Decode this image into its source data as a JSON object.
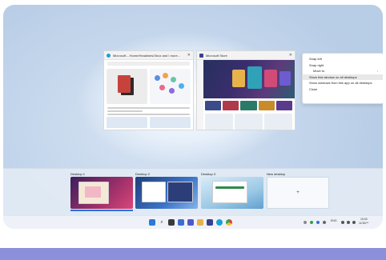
{
  "edge_window": {
    "title": "Microsoft – Home/Headlines/Xbox and I more...",
    "close_glyph": "✕"
  },
  "store_window": {
    "title": "Microsoft Store",
    "close_glyph": "✕"
  },
  "context_menu": {
    "items": [
      {
        "label": "Snap left"
      },
      {
        "label": "Snap right"
      },
      {
        "label": "Move to",
        "has_submenu": true
      },
      {
        "label": "Show this window on all desktops",
        "highlighted": true
      },
      {
        "label": "Show windows from this app on all desktops"
      },
      {
        "label": "Close"
      }
    ],
    "submenu_arrow": "›"
  },
  "desktops": [
    {
      "label": "Desktop 1",
      "active": true
    },
    {
      "label": "Desktop 2",
      "active": false
    },
    {
      "label": "Desktop 3",
      "active": false
    }
  ],
  "new_desktop": {
    "label": "New desktop",
    "glyph": "+"
  },
  "taskbar": {
    "icons": [
      {
        "name": "start-icon",
        "color": "#2b79d8"
      },
      {
        "name": "search-icon",
        "color": "#3a3a3a"
      },
      {
        "name": "widgets-icon",
        "color": "#3a3a3a"
      },
      {
        "name": "task-view-icon",
        "color": "#3a6fcf"
      },
      {
        "name": "chat-icon",
        "color": "#5059c9"
      },
      {
        "name": "file-explorer-icon",
        "color": "#e8b14a"
      },
      {
        "name": "store-icon",
        "color": "#3b3f8f"
      },
      {
        "name": "edge-icon",
        "color": "#1d9fd6"
      },
      {
        "name": "chrome-icon",
        "color": "#d9483b"
      }
    ],
    "tray_text": "ENG",
    "clock_time": "15:00",
    "clock_date": "11/30/**"
  },
  "colors": {
    "accent": "#2f6fd6",
    "bottom_band": "#8c8fd9"
  }
}
